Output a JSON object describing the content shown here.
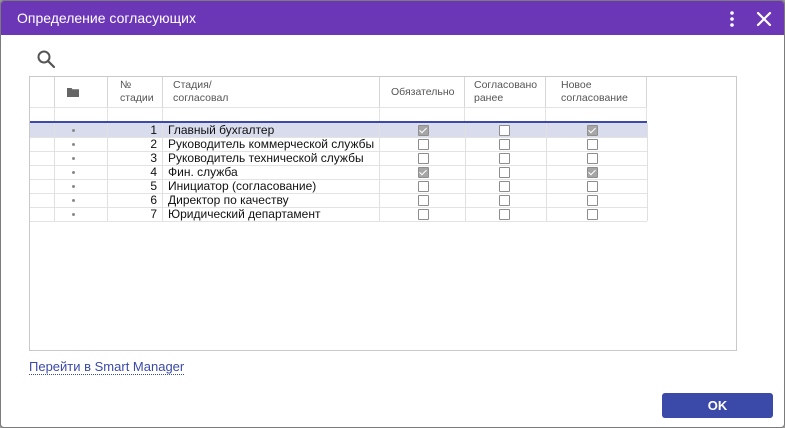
{
  "dialog": {
    "title": "Определение согласующих",
    "link_text": "Перейти в Smart Manager",
    "ok_label": "OK"
  },
  "columns": {
    "stage_no_line1": "№",
    "stage_no_line2": "стадии",
    "stage_name_line1": "Стадия/",
    "stage_name_line2": "согласовал",
    "required": "Обязательно",
    "approved_before_line1": "Согласовано",
    "approved_before_line2": "ранее",
    "new_approval_line1": "Новое",
    "new_approval_line2": "согласование"
  },
  "rows": [
    {
      "no": "1",
      "name": "Главный бухгалтер",
      "required": true,
      "approved_before": false,
      "new_approval": true
    },
    {
      "no": "2",
      "name": "Руководитель коммерческой службы",
      "required": false,
      "approved_before": false,
      "new_approval": false
    },
    {
      "no": "3",
      "name": "Руководитель технической службы",
      "required": false,
      "approved_before": false,
      "new_approval": false
    },
    {
      "no": "4",
      "name": "Фин. служба",
      "required": true,
      "approved_before": false,
      "new_approval": true
    },
    {
      "no": "5",
      "name": "Инициатор (согласование)",
      "required": false,
      "approved_before": false,
      "new_approval": false
    },
    {
      "no": "6",
      "name": "Директор по качеству",
      "required": false,
      "approved_before": false,
      "new_approval": false
    },
    {
      "no": "7",
      "name": "Юридический департамент",
      "required": false,
      "approved_before": false,
      "new_approval": false
    }
  ],
  "selected_row": 1,
  "colors": {
    "title_bar": "#6c37b7",
    "accent": "#3b4aa8",
    "selected_row": "#d9dcec"
  },
  "icons": {
    "search": "search-icon",
    "menu": "more-vertical-icon",
    "close": "close-icon",
    "folder": "folder-icon"
  }
}
